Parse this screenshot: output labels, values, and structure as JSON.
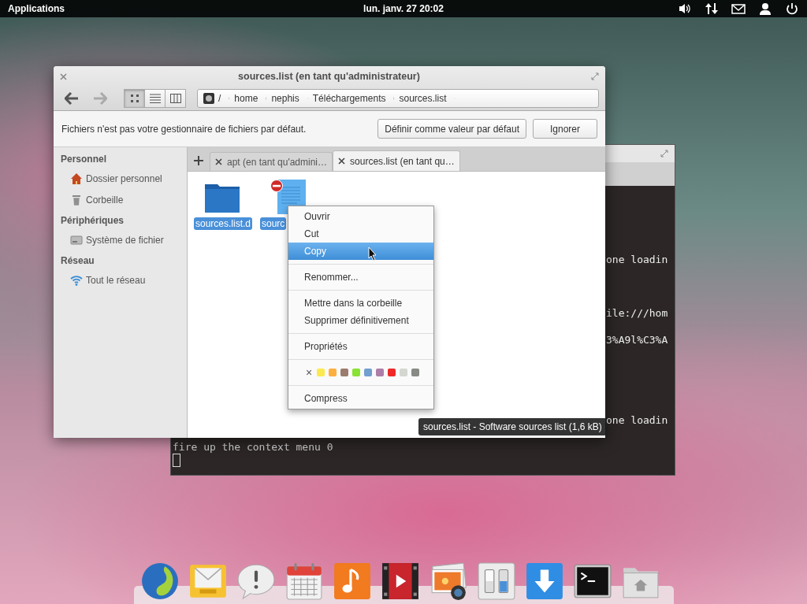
{
  "top_panel": {
    "menu": "Applications",
    "clock": "lun. janv. 27 20:02"
  },
  "terminal": {
    "fragments": [
      {
        "text": "one loadin"
      },
      {
        "text": "ile:///hom"
      },
      {
        "text": "3%A9l%C3%A"
      },
      {
        "text": "one loadin"
      }
    ],
    "lines": [
      {
        "text": "fire up the context menu 0"
      }
    ]
  },
  "file_manager": {
    "title": "sources.list (en tant qu'administrateur)",
    "nav": [
      {
        "kind": "back",
        "disabled": false
      },
      {
        "kind": "forward",
        "disabled": true
      }
    ],
    "view_modes": [
      {
        "kind": "grid",
        "selected": true
      },
      {
        "kind": "list",
        "selected": false
      },
      {
        "kind": "columns",
        "selected": false
      }
    ],
    "breadcrumb": [
      "/",
      "home",
      "nephis",
      "Téléchargements",
      "sources.list"
    ],
    "infobar": {
      "message": "Fichiers n'est pas votre gestionnaire de fichiers par défaut.",
      "buttons": [
        "Définir comme valeur par défaut",
        "Ignorer"
      ]
    },
    "sidebar": [
      {
        "heading": "Personnel",
        "items": [
          {
            "kind": "home",
            "label": "Dossier personnel"
          },
          {
            "kind": "trash",
            "label": "Corbeille"
          }
        ]
      },
      {
        "heading": "Périphériques",
        "items": [
          {
            "kind": "drive",
            "label": "Système de fichier"
          }
        ]
      },
      {
        "heading": "Réseau",
        "items": [
          {
            "kind": "network",
            "label": "Tout le réseau"
          }
        ]
      }
    ],
    "tabs": [
      {
        "label": "apt (en tant qu'admini…",
        "selected": false
      },
      {
        "label": "sources.list (en tant qu…",
        "selected": true
      }
    ],
    "files": [
      {
        "kind": "folder",
        "name": "sources.list.d",
        "selected": true
      },
      {
        "kind": "document",
        "name": "sourc",
        "selected": true
      }
    ]
  },
  "context_menu": [
    {
      "kind": "item",
      "label": "Ouvrir",
      "selected": false
    },
    {
      "kind": "item",
      "label": "Cut",
      "selected": false
    },
    {
      "kind": "item",
      "label": "Copy",
      "selected": true
    },
    {
      "kind": "separator"
    },
    {
      "kind": "item",
      "label": "Renommer...",
      "selected": false
    },
    {
      "kind": "separator"
    },
    {
      "kind": "item",
      "label": "Mettre dans la corbeille",
      "selected": false
    },
    {
      "kind": "item",
      "label": "Supprimer définitivement",
      "selected": false
    },
    {
      "kind": "separator"
    },
    {
      "kind": "item",
      "label": "Propriétés",
      "selected": false
    },
    {
      "kind": "separator"
    },
    {
      "kind": "tags",
      "clear": "×",
      "colors": [
        {
          "color": "#fce94f"
        },
        {
          "color": "#fcaf3e"
        },
        {
          "color": "#9b7b6b"
        },
        {
          "color": "#8ae234"
        },
        {
          "color": "#729fcf"
        },
        {
          "color": "#ad7fa8"
        },
        {
          "color": "#ef2929"
        },
        {
          "color": "#d3d7cf"
        },
        {
          "color": "#888a85"
        }
      ]
    },
    {
      "kind": "separator"
    },
    {
      "kind": "item",
      "label": "Compress",
      "selected": false
    }
  ],
  "tooltip": "sources.list - Software sources list (1,6 kB)",
  "dock": [
    {
      "kind": "globe"
    },
    {
      "kind": "mail"
    },
    {
      "kind": "bubble"
    },
    {
      "kind": "calendar"
    },
    {
      "kind": "music"
    },
    {
      "kind": "film"
    },
    {
      "kind": "photo"
    },
    {
      "kind": "switch"
    },
    {
      "kind": "download"
    },
    {
      "kind": "terminal"
    },
    {
      "kind": "folder"
    }
  ]
}
